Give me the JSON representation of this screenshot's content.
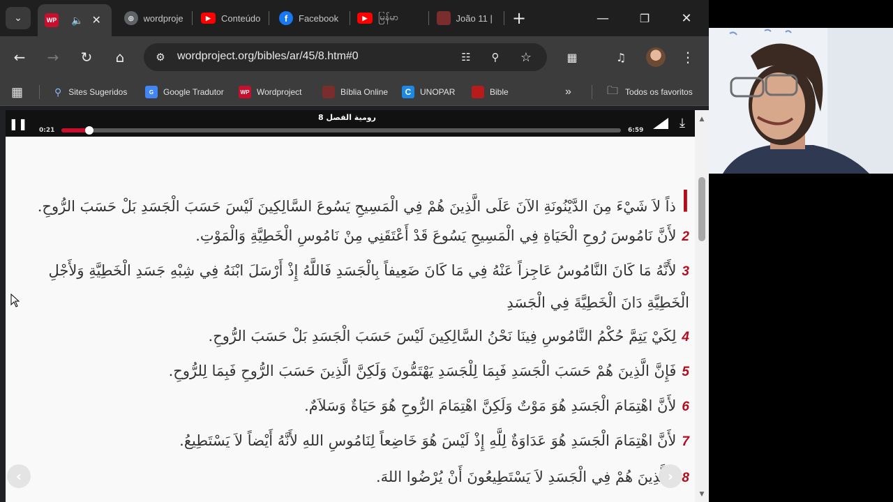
{
  "tabs": [
    {
      "title": "",
      "favicon": "WP",
      "active": true
    },
    {
      "title": "wordproje",
      "favicon": "globe-icon"
    },
    {
      "title": "Conteúdo",
      "favicon": "youtube-icon"
    },
    {
      "title": "Facebook",
      "favicon": "facebook-icon"
    },
    {
      "title": "မြန်မာ",
      "favicon": "youtube-icon"
    },
    {
      "title": "João 11 |",
      "favicon": "bible-icon"
    }
  ],
  "address_bar": {
    "url": "wordproject.org/bibles/ar/45/8.htm#0"
  },
  "bookmarks": [
    {
      "label": "Sites Sugeridos"
    },
    {
      "label": "Google Tradutor"
    },
    {
      "label": "Wordproject"
    },
    {
      "label": "Bíblia Online"
    },
    {
      "label": "UNOPAR"
    },
    {
      "label": "Bible"
    }
  ],
  "bookmarks_more": "»",
  "all_bookmarks": "Todos os favoritos",
  "player": {
    "title": "رومية الفصل 8",
    "current_time": "0:21",
    "total_time": "6:59",
    "progress": 0.05
  },
  "verses": [
    {
      "num": "ا",
      "text": "ذاً لاَ شَيْءَ مِنَ الدَّيْنُونَةِ الآنَ عَلَى الَّذِينَ هُمْ فِي الْمَسِيحِ يَسُوعَ السَّالِكِينَ لَيْسَ حَسَبَ الْجَسَدِ بَلْ حَسَبَ الرُّوحِ."
    },
    {
      "num": "2",
      "text": "لأَنَّ نَامُوسَ رُوحِ الْحَيَاةِ فِي الْمَسِيحِ يَسُوعَ قَدْ أَعْتَقَنِي مِنْ نَامُوسِ الْخَطِيَّةِ وَالْمَوْتِ."
    },
    {
      "num": "3",
      "text": "لأَنَّهُ مَا كَانَ النَّامُوسُ عَاجِزاً عَنْهُ فِي مَا كَانَ ضَعِيفاً بِالْجَسَدِ فَاللَّهُ إِذْ أَرْسَلَ ابْنَهُ فِي شِبْهِ جَسَدِ الْخَطِيَّةِ وَلأَجْلِ الْخَطِيَّةِ دَانَ الْخَطِيَّةَ فِي الْجَسَدِ"
    },
    {
      "num": "4",
      "text": "لِكَيْ يَتِمَّ حُكْمُ النَّامُوسِ فِينَا نَحْنُ السَّالِكِينَ لَيْسَ حَسَبَ الْجَسَدِ بَلْ حَسَبَ الرُّوحِ."
    },
    {
      "num": "5",
      "text": "فَإِنَّ الَّذِينَ هُمْ حَسَبَ الْجَسَدِ فَبِمَا لِلْجَسَدِ يَهْتَمُّونَ وَلَكِنَّ الَّذِينَ حَسَبَ الرُّوحِ فَبِمَا لِلرُّوحِ."
    },
    {
      "num": "6",
      "text": "لأَنَّ اهْتِمَامَ الْجَسَدِ هُوَ مَوْتٌ وَلَكِنَّ اهْتِمَامَ الرُّوحِ هُوَ حَيَاةٌ وَسَلاَمٌ."
    },
    {
      "num": "7",
      "text": "لأَنَّ اهْتِمَامَ الْجَسَدِ هُوَ عَدَاوَةٌ لِلَّهِ إِذْ لَيْسَ هُوَ خَاضِعاً لِنَامُوسِ اللهِ لأَنَّهُ أَيْضاً لاَ يَسْتَطِيعُ."
    },
    {
      "num": "8",
      "text": "فَالَّذِينَ هُمْ فِي الْجَسَدِ لاَ يَسْتَطِيعُونَ أَنْ يُرْضُوا اللهَ."
    }
  ],
  "colors": {
    "verse_number": "#b40c1e",
    "player_progress": "#c8102e",
    "text": "#333333"
  }
}
